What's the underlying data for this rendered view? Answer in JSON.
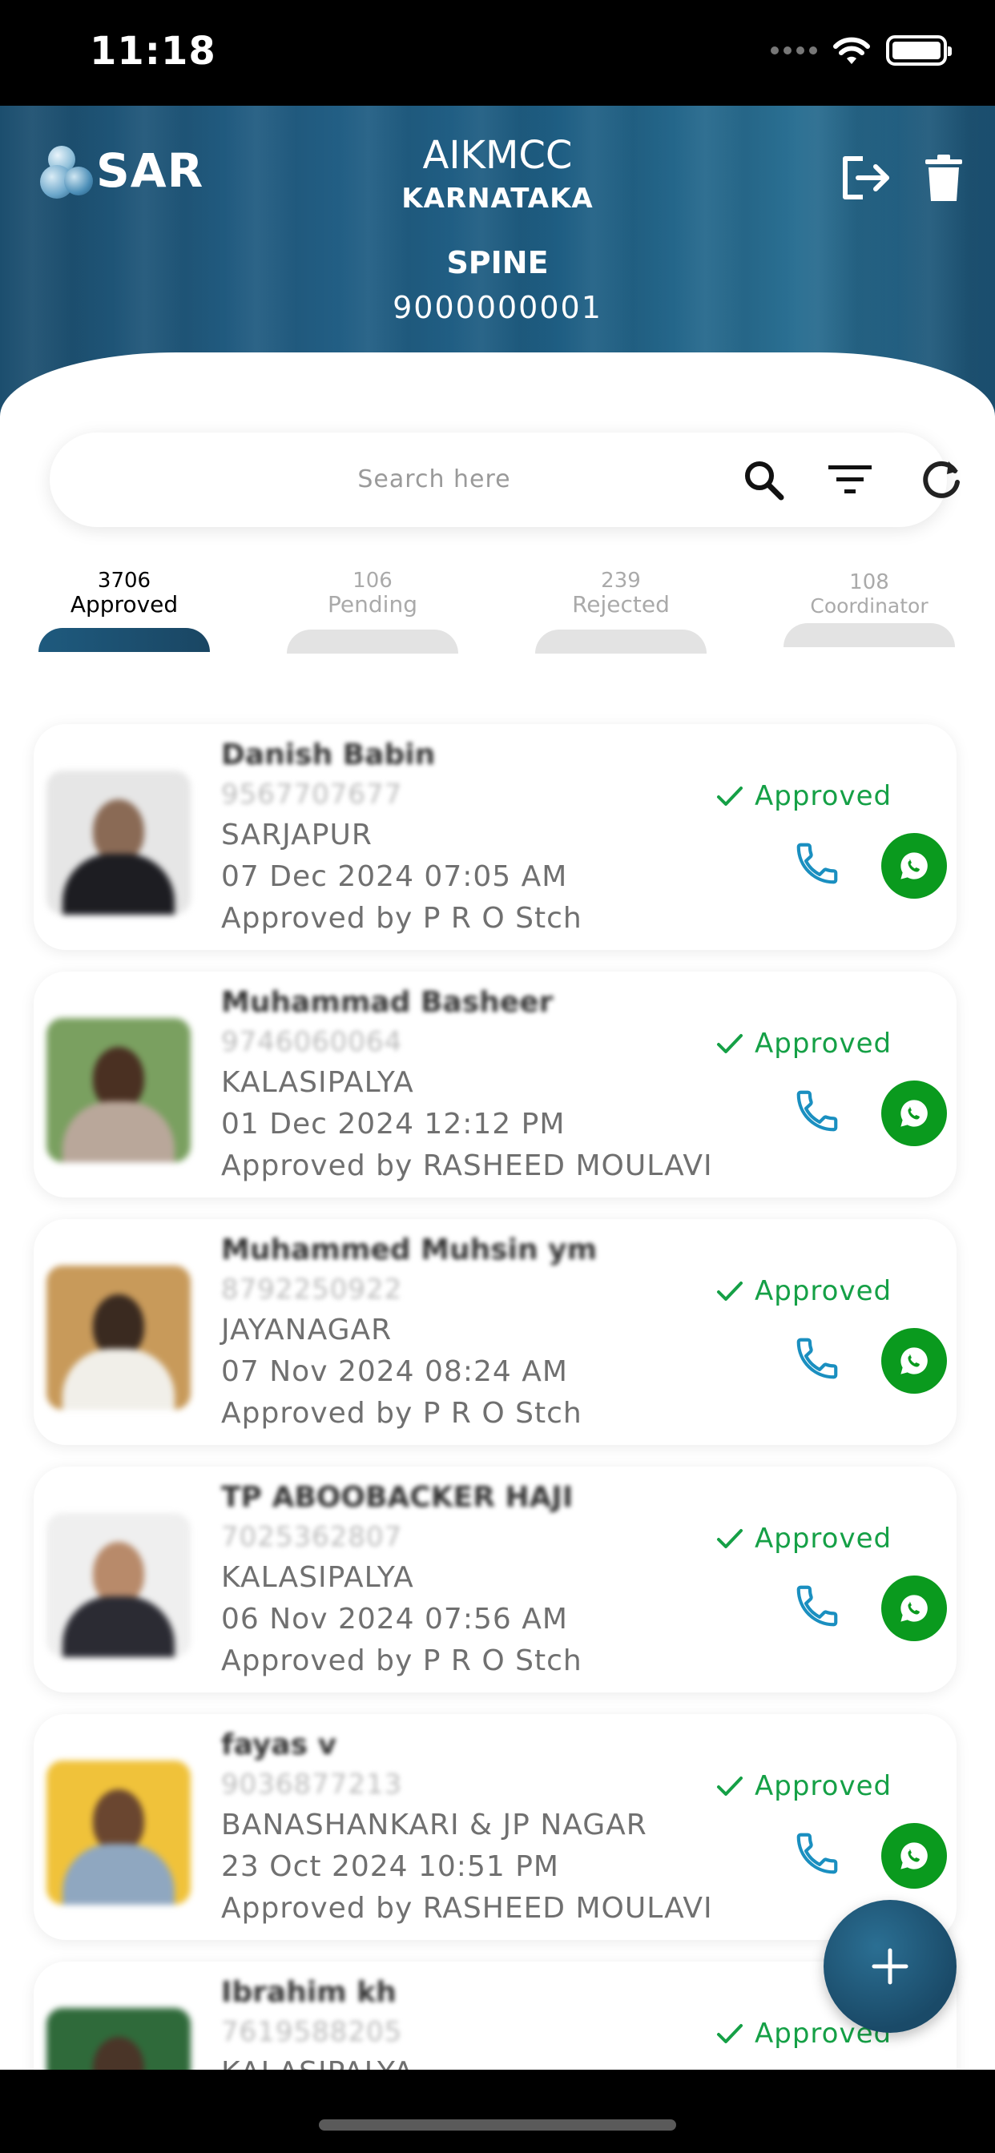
{
  "status_bar": {
    "time": "11:18"
  },
  "header": {
    "logo_text": "SAR",
    "org_name": "AIKMCC",
    "org_state": "KARNATAKA",
    "user_name": "SPINE",
    "user_phone": "9000000001",
    "logout_icon": "logout-icon",
    "delete_icon": "trash-icon"
  },
  "search": {
    "placeholder": "Search here"
  },
  "tabs": [
    {
      "count": "3706",
      "label": "Approved",
      "active": true
    },
    {
      "count": "106",
      "label": "Pending",
      "active": false
    },
    {
      "count": "239",
      "label": "Rejected",
      "active": false
    },
    {
      "count": "108",
      "label": "Coordinator",
      "active": false
    }
  ],
  "records": [
    {
      "name": "Danish Babin",
      "phone": "9567707677",
      "area": "SARJAPUR",
      "date": "07 Dec 2024  07:05 AM",
      "approved_by": "Approved by P R O Stch",
      "status": "Approved"
    },
    {
      "name": "Muhammad Basheer",
      "phone": "9746060064",
      "area": "KALASIPALYA",
      "date": "01 Dec 2024  12:12 PM",
      "approved_by": "Approved by RASHEED MOULAVI",
      "status": "Approved"
    },
    {
      "name": "Muhammed Muhsin ym",
      "phone": "8792250922",
      "area": "JAYANAGAR",
      "date": "07 Nov 2024  08:24 AM",
      "approved_by": "Approved by P R O Stch",
      "status": "Approved"
    },
    {
      "name": "TP ABOOBACKER HAJI",
      "phone": "7025362807",
      "area": "KALASIPALYA",
      "date": "06 Nov 2024  07:56 AM",
      "approved_by": "Approved by P R O Stch",
      "status": "Approved"
    },
    {
      "name": "fayas v",
      "phone": "9036877213",
      "area": "BANASHANKARI & JP NAGAR",
      "date": "23 Oct 2024  10:51 PM",
      "approved_by": "Approved by RASHEED MOULAVI",
      "status": "Approved"
    },
    {
      "name": "Ibrahim kh",
      "phone": "7619588205",
      "area": "KALASIPALYA",
      "date": "",
      "approved_by": "",
      "status": "Approved"
    }
  ],
  "fab": {
    "icon": "plus-icon"
  },
  "colors": {
    "primary": "#1e5a7e",
    "approved": "#15a046",
    "whatsapp": "#0a9a1e",
    "call": "#1a8fc0"
  }
}
